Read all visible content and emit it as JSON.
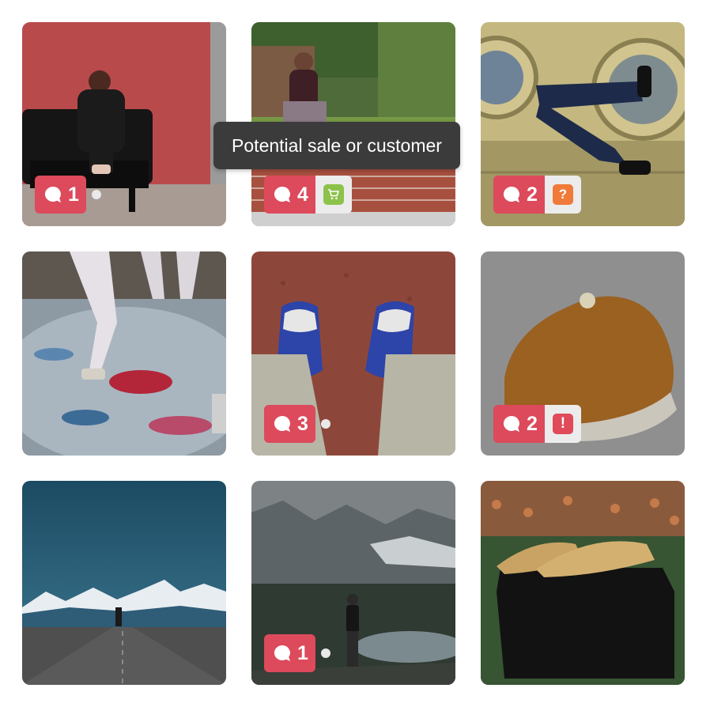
{
  "tooltip": {
    "text": "Potential sale or customer"
  },
  "tiles": [
    {
      "comment_count": "1",
      "flag": null
    },
    {
      "comment_count": "4",
      "flag": "cart",
      "flag_glyph": ""
    },
    {
      "comment_count": "2",
      "flag": "question",
      "flag_glyph": "?"
    },
    {
      "comment_count": null,
      "flag": null
    },
    {
      "comment_count": "3",
      "flag": null
    },
    {
      "comment_count": "2",
      "flag": "alert",
      "flag_glyph": "!"
    },
    {
      "comment_count": null,
      "flag": null
    },
    {
      "comment_count": "1",
      "flag": null
    },
    {
      "comment_count": null,
      "flag": null
    }
  ],
  "colors": {
    "comment_badge": "#dc4a5b",
    "flag_cart": "#8dc24a",
    "flag_question": "#f07a39",
    "flag_alert": "#e04a59",
    "tooltip_bg": "#3b3b3b"
  },
  "icons": {
    "comment": "speech-bubble-icon",
    "cart": "shopping-cart-icon",
    "question": "question-mark-icon",
    "alert": "exclamation-icon"
  }
}
